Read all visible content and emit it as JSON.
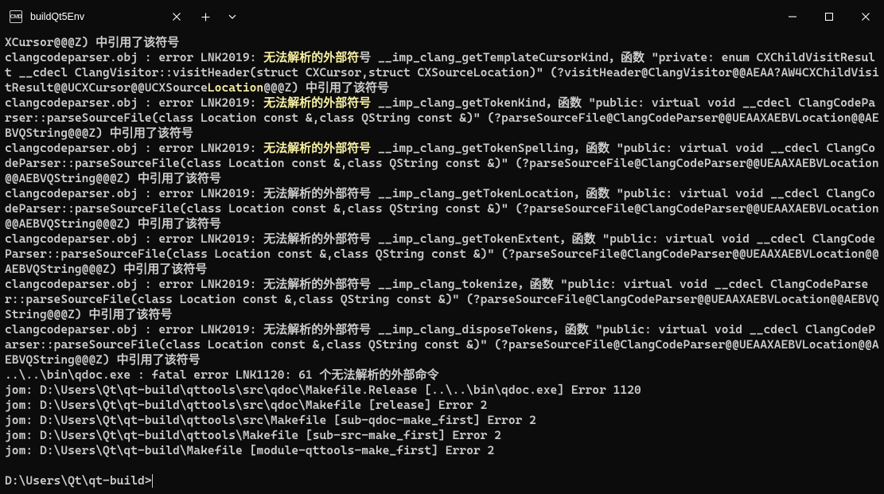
{
  "titlebar": {
    "tab": {
      "title": "buildQt5Env",
      "icon_label": "CMD"
    }
  },
  "terminal": {
    "lines": [
      {
        "segments": [
          {
            "t": "XCursor@@@Z) 中引用了该符号",
            "c": ""
          }
        ]
      },
      {
        "segments": [
          {
            "t": "clangcodeparser.obj : error LNK2019: ",
            "c": ""
          },
          {
            "t": "无法解析的外部符",
            "c": "err-yellow"
          },
          {
            "t": "号 __imp_clang_getTemplateCursorKind，函数 \"private: enum CXChildVisitResult __cdecl ClangVisitor::visitHeader(struct CXCursor,struct CXSourceLocation)\" (?visitHeader@ClangVisitor@@AEAA?AW4CXChildVisitResult@@UCXCursor@@UCXSource",
            "c": ""
          },
          {
            "t": "Location",
            "c": "err-yellow"
          },
          {
            "t": "@@@Z) 中引用了该符号",
            "c": ""
          }
        ]
      },
      {
        "segments": [
          {
            "t": "clangcodeparser.obj : error LNK2019: ",
            "c": ""
          },
          {
            "t": "无法解析的外部符号",
            "c": "err-yellow"
          },
          {
            "t": " __imp_clang_getTokenKind，函数 \"public: virtual void __cdecl ClangCodeParser::parseSourceFile(class Location const &,class QString const &)\" (?parseSourceFile@ClangCodeParser@@UEAAXAEBVLocation@@AEBVQString@@@Z) 中引用了该符号",
            "c": ""
          }
        ]
      },
      {
        "segments": [
          {
            "t": "clangcodeparser.obj : error LNK2019: ",
            "c": ""
          },
          {
            "t": "无法解析的外部符号",
            "c": "err-yellow"
          },
          {
            "t": " __imp_clang_getTokenSpelling，函数 \"public: virtual void __cdecl ClangCodeParser::parseSourceFile(class Location const &,class QString const &)\" (?parseSourceFile@ClangCodeParser@@UEAAXAEBVLocation@@AEBVQString@@@Z) 中引用了该符号",
            "c": ""
          }
        ]
      },
      {
        "segments": [
          {
            "t": "clangcodeparser.obj : error LNK2019: 无法解析的外部符号 __imp_clang_getTokenLocation，函数 \"public: virtual void __cdecl ClangCodeParser::parseSourceFile(class Location const &,class QString const &)\" (?parseSourceFile@ClangCodeParser@@UEAAXAEBVLocation@@AEBVQString@@@Z) 中引用了该符号",
            "c": ""
          }
        ]
      },
      {
        "segments": [
          {
            "t": "clangcodeparser.obj : error LNK2019: 无法解析的外部符号 __imp_clang_getTokenExtent，函数 \"public: virtual void __cdecl ClangCodeParser::parseSourceFile(class Location const &,class QString const &)\" (?parseSourceFile@ClangCodeParser@@UEAAXAEBVLocation@@AEBVQString@@@Z) 中引用了该符号",
            "c": ""
          }
        ]
      },
      {
        "segments": [
          {
            "t": "clangcodeparser.obj : error LNK2019: 无法解析的外部符号 __imp_clang_tokenize，函数 \"public: virtual void __cdecl ClangCodeParser::parseSourceFile(class Location const &,class QString const &)\" (?parseSourceFile@ClangCodeParser@@UEAAXAEBVLocation@@AEBVQString@@@Z) 中引用了该符号",
            "c": ""
          }
        ]
      },
      {
        "segments": [
          {
            "t": "clangcodeparser.obj : error LNK2019: 无法解析的外部符号 __imp_clang_disposeTokens，函数 \"public: virtual void __cdecl ClangCodeParser::parseSourceFile(class Location const &,class QString const &)\" (?parseSourceFile@ClangCodeParser@@UEAAXAEBVLocation@@AEBVQString@@@Z) 中引用了该符号",
            "c": ""
          }
        ]
      },
      {
        "segments": [
          {
            "t": "..\\..\\bin\\qdoc.exe : fatal error LNK1120: 61 个无法解析的外部命令",
            "c": ""
          }
        ]
      },
      {
        "segments": [
          {
            "t": "jom: D:\\Users\\Qt\\qt-build\\qttools\\src\\qdoc\\Makefile.Release [..\\..\\bin\\qdoc.exe] Error 1120",
            "c": ""
          }
        ]
      },
      {
        "segments": [
          {
            "t": "jom: D:\\Users\\Qt\\qt-build\\qttools\\src\\qdoc\\Makefile [release] Error 2",
            "c": ""
          }
        ]
      },
      {
        "segments": [
          {
            "t": "jom: D:\\Users\\Qt\\qt-build\\qttools\\src\\Makefile [sub-qdoc-make_first] Error 2",
            "c": ""
          }
        ]
      },
      {
        "segments": [
          {
            "t": "jom: D:\\Users\\Qt\\qt-build\\qttools\\Makefile [sub-src-make_first] Error 2",
            "c": ""
          }
        ]
      },
      {
        "segments": [
          {
            "t": "jom: D:\\Users\\Qt\\qt-build\\Makefile [module-qttools-make_first] Error 2",
            "c": ""
          }
        ]
      }
    ],
    "blank": "",
    "prompt": "D:\\Users\\Qt\\qt-build>"
  }
}
